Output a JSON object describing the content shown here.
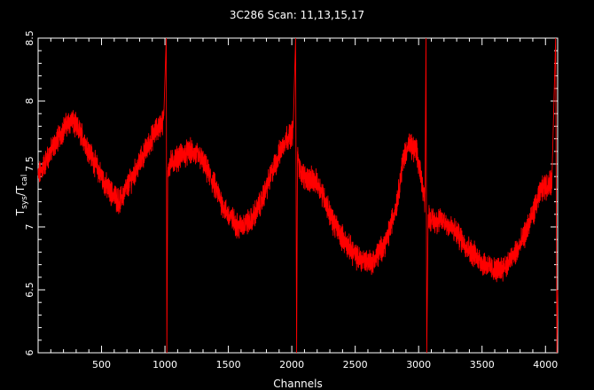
{
  "chart_data": {
    "type": "line",
    "title": "3C286 Scan: 11,13,15,17",
    "xlabel": "Channels",
    "ylabel": {
      "base": "T",
      "sub1": "sys",
      "sep": "/",
      "base2": "T",
      "sub2": "cal"
    },
    "xlim": [
      0,
      4096
    ],
    "ylim": [
      6,
      8.5
    ],
    "x_ticks": [
      500,
      1000,
      1500,
      2000,
      2500,
      3000,
      3500,
      4000
    ],
    "x_tick_labels": [
      "500",
      "1000",
      "1500",
      "2000",
      "2500",
      "3000",
      "3500",
      "4000"
    ],
    "y_ticks": [
      6,
      6.5,
      7,
      7.5,
      8,
      8.5
    ],
    "y_tick_labels": [
      "6",
      "6.5",
      "7",
      "7.5",
      "8",
      "8.5"
    ],
    "grid": false,
    "colors": {
      "background": "#000000",
      "axes": "#ffffff",
      "series": "#ff0000"
    },
    "series": [
      {
        "color": "#ff0000",
        "noise_amplitude": 0.08,
        "x": [
          0,
          100,
          200,
          260,
          350,
          450,
          550,
          640,
          720,
          820,
          920,
          990,
          1010,
          1015,
          1022,
          1040,
          1100,
          1200,
          1280,
          1380,
          1480,
          1580,
          1680,
          1760,
          1850,
          1950,
          2010,
          2030,
          2038,
          2045,
          2060,
          2100,
          2200,
          2250,
          2320,
          2420,
          2520,
          2640,
          2750,
          2830,
          2880,
          2920,
          2980,
          3020,
          3050,
          3058,
          3064,
          3075,
          3100,
          3200,
          3300,
          3400,
          3500,
          3600,
          3700,
          3800,
          3900,
          3970,
          4050,
          4080,
          4090,
          4096
        ],
        "y": [
          7.4,
          7.6,
          7.78,
          7.85,
          7.72,
          7.5,
          7.3,
          7.2,
          7.35,
          7.55,
          7.75,
          7.85,
          8.5,
          6.0,
          7.45,
          7.5,
          7.55,
          7.6,
          7.55,
          7.35,
          7.12,
          7.0,
          7.05,
          7.2,
          7.45,
          7.7,
          7.75,
          8.5,
          6.0,
          7.6,
          7.45,
          7.4,
          7.35,
          7.25,
          7.05,
          6.88,
          6.75,
          6.72,
          6.9,
          7.2,
          7.55,
          7.65,
          7.6,
          7.4,
          7.2,
          8.5,
          6.0,
          7.1,
          7.05,
          7.05,
          6.95,
          6.82,
          6.72,
          6.65,
          6.7,
          6.85,
          7.1,
          7.3,
          7.35,
          8.5,
          6.0,
          6.5
        ]
      }
    ]
  }
}
